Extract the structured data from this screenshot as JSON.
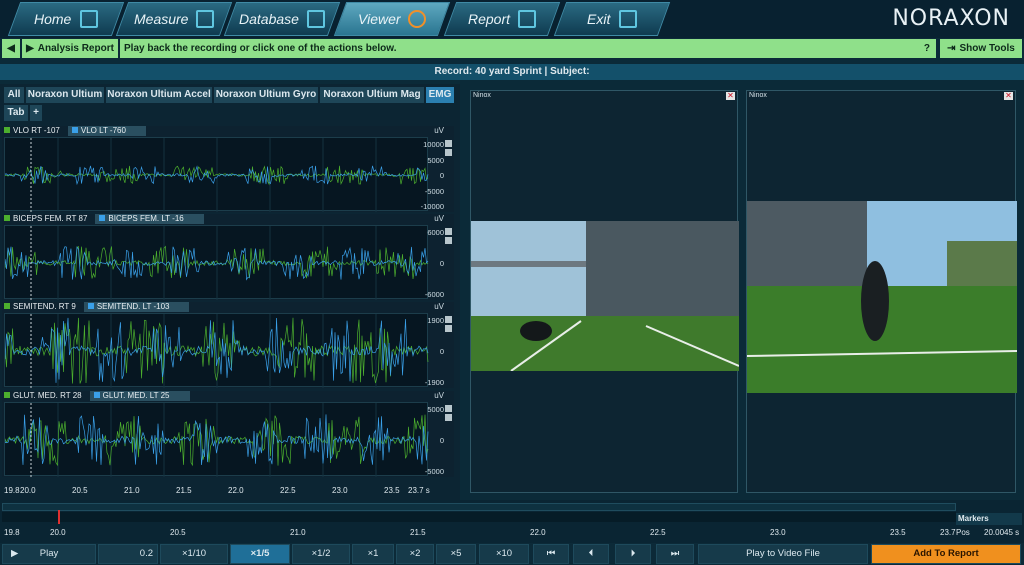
{
  "nav": {
    "tabs": [
      {
        "label": "Home",
        "icon": "home-icon"
      },
      {
        "label": "Measure",
        "icon": "measure-icon"
      },
      {
        "label": "Database",
        "icon": "database-icon"
      },
      {
        "label": "Viewer",
        "icon": "viewer-icon"
      },
      {
        "label": "Report",
        "icon": "report-icon"
      },
      {
        "label": "Exit",
        "icon": "exit-arrow-icon"
      }
    ],
    "logo": "NORAXON"
  },
  "actionbar": {
    "back_icon": "chevron-left-icon",
    "analysis_label": "Analysis Report",
    "message": "Play back the recording or click one of the actions below.",
    "help": "?",
    "show_tools": "Show Tools",
    "colors": {
      "accent": "#8fe08a"
    }
  },
  "record": {
    "title": "Record: 40 yard Sprint | Subject:"
  },
  "channel_tabs": [
    "All",
    "Noraxon Ultium",
    "Noraxon Ultium Accel",
    "Noraxon Ultium Gyro",
    "Noraxon Ultium Mag",
    "EMG"
  ],
  "tab_labels": {
    "tab": "Tab",
    "add": "+"
  },
  "channels": [
    {
      "a_name": "VLO RT",
      "a_val": "-107",
      "b_name": "VLO LT",
      "b_val": "-760",
      "unit": "uV",
      "ticks": [
        "10000",
        "5000",
        "0",
        "-5000",
        "-10000"
      ]
    },
    {
      "a_name": "BICEPS FEM. RT",
      "a_val": "87",
      "b_name": "BICEPS FEM. LT",
      "b_val": "-16",
      "unit": "uV",
      "ticks": [
        "6000",
        "0",
        "-6000"
      ]
    },
    {
      "a_name": "SEMITEND. RT",
      "a_val": "9",
      "b_name": "SEMITEND. LT",
      "b_val": "-103",
      "unit": "uV",
      "ticks": [
        "1900",
        "0",
        "-1900"
      ]
    },
    {
      "a_name": "GLUT. MED. RT",
      "a_val": "28",
      "b_name": "GLUT. MED. LT",
      "b_val": "25",
      "unit": "uV",
      "ticks": [
        "5000",
        "0",
        "-5000"
      ]
    }
  ],
  "xaxis": {
    "labels": [
      "19.8",
      "20.0",
      "20.5",
      "21.0",
      "21.5",
      "22.0",
      "22.5",
      "23.0",
      "23.5",
      "23.7 s"
    ]
  },
  "videos": [
    {
      "title": "Ninox"
    },
    {
      "title": "Ninox"
    }
  ],
  "timeline": {
    "labels": [
      "19.8",
      "20.0",
      "20.5",
      "21.0",
      "21.5",
      "22.0",
      "22.5",
      "23.0",
      "23.5",
      "23.7"
    ],
    "markers": "Markers",
    "pos_label": "Pos",
    "pos_value": "20.0045 s"
  },
  "playback": {
    "play_icon": "play-icon",
    "play": "Play",
    "speed_value": "0.2",
    "speeds": [
      "×1/10",
      "×1/5",
      "×1/2",
      "×1",
      "×2",
      "×5",
      "×10"
    ],
    "selected_speed": "×1/5",
    "transport_icons": [
      "skip-to-start-icon",
      "step-back-icon",
      "step-forward-icon",
      "skip-to-end-icon"
    ],
    "play_to_video": "Play to Video File",
    "add_to_report": "Add To Report",
    "colors": {
      "orange": "#f0901e",
      "selected": "#1f6f98"
    }
  },
  "colors": {
    "rt_signal": "#4caf2e",
    "lt_signal": "#3aa0e8",
    "cursor": "#e03030"
  }
}
